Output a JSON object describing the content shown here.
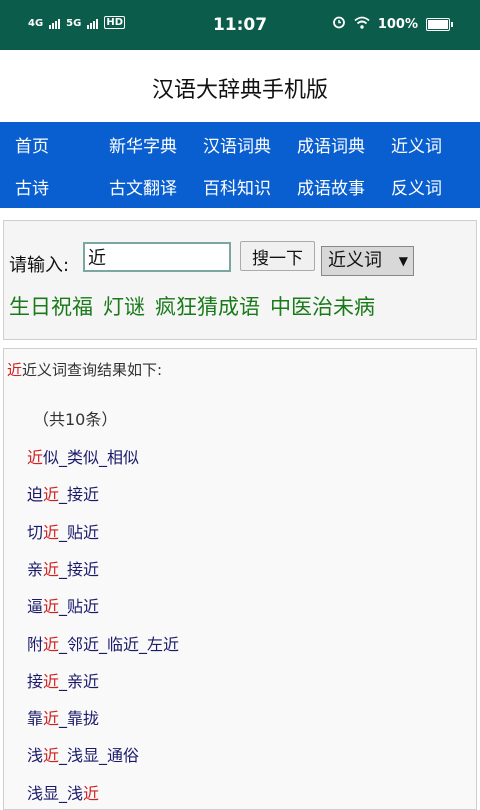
{
  "status_bar": {
    "network_left": "4G",
    "network_right": "5G",
    "hd_label": "HD",
    "time": "11:07",
    "battery": "100%",
    "alarm_icon": "alarm-clock-icon",
    "wifi_icon": "wifi-icon",
    "battery_icon": "battery-icon"
  },
  "header": {
    "title": "汉语大辞典手机版"
  },
  "nav": {
    "row1": [
      "首页",
      "新华字典",
      "汉语词典",
      "成语词典",
      "近义词"
    ],
    "row2": [
      "古诗",
      "古文翻译",
      "百科知识",
      "成语故事",
      "反义词"
    ]
  },
  "search": {
    "label": "请输入:",
    "input_value": "近",
    "button_label": "搜一下",
    "select_value": "近义词",
    "quick_links": [
      "生日祝福",
      "灯谜",
      "疯狂猜成语",
      "中医治未病"
    ]
  },
  "results": {
    "query": "近",
    "header_text": "近义词查询结果如下:",
    "count_text": "（共10条）",
    "items": [
      [
        {
          "t": "近",
          "h": true
        },
        {
          "t": "似_类似_相似",
          "h": false
        }
      ],
      [
        {
          "t": "迫",
          "h": false
        },
        {
          "t": "近",
          "h": true
        },
        {
          "t": "_接近",
          "h": false
        }
      ],
      [
        {
          "t": "切",
          "h": false
        },
        {
          "t": "近",
          "h": true
        },
        {
          "t": "_贴近",
          "h": false
        }
      ],
      [
        {
          "t": "亲",
          "h": false
        },
        {
          "t": "近",
          "h": true
        },
        {
          "t": "_接近",
          "h": false
        }
      ],
      [
        {
          "t": "逼",
          "h": false
        },
        {
          "t": "近",
          "h": true
        },
        {
          "t": "_贴近",
          "h": false
        }
      ],
      [
        {
          "t": "附",
          "h": false
        },
        {
          "t": "近",
          "h": true
        },
        {
          "t": "_邻近_临近_左近",
          "h": false
        }
      ],
      [
        {
          "t": "接",
          "h": false
        },
        {
          "t": "近",
          "h": true
        },
        {
          "t": "_亲近",
          "h": false
        }
      ],
      [
        {
          "t": "靠",
          "h": false
        },
        {
          "t": "近",
          "h": true
        },
        {
          "t": "_靠拢",
          "h": false
        }
      ],
      [
        {
          "t": "浅",
          "h": false
        },
        {
          "t": "近",
          "h": true
        },
        {
          "t": "_浅显_通俗",
          "h": false
        }
      ],
      [
        {
          "t": "浅显_浅",
          "h": false
        },
        {
          "t": "近",
          "h": true
        }
      ]
    ]
  },
  "colors": {
    "status_bar": "#0b5c4a",
    "nav": "#0a5fd0",
    "highlight": "#d02020",
    "quick_link": "#1a7a1a"
  }
}
